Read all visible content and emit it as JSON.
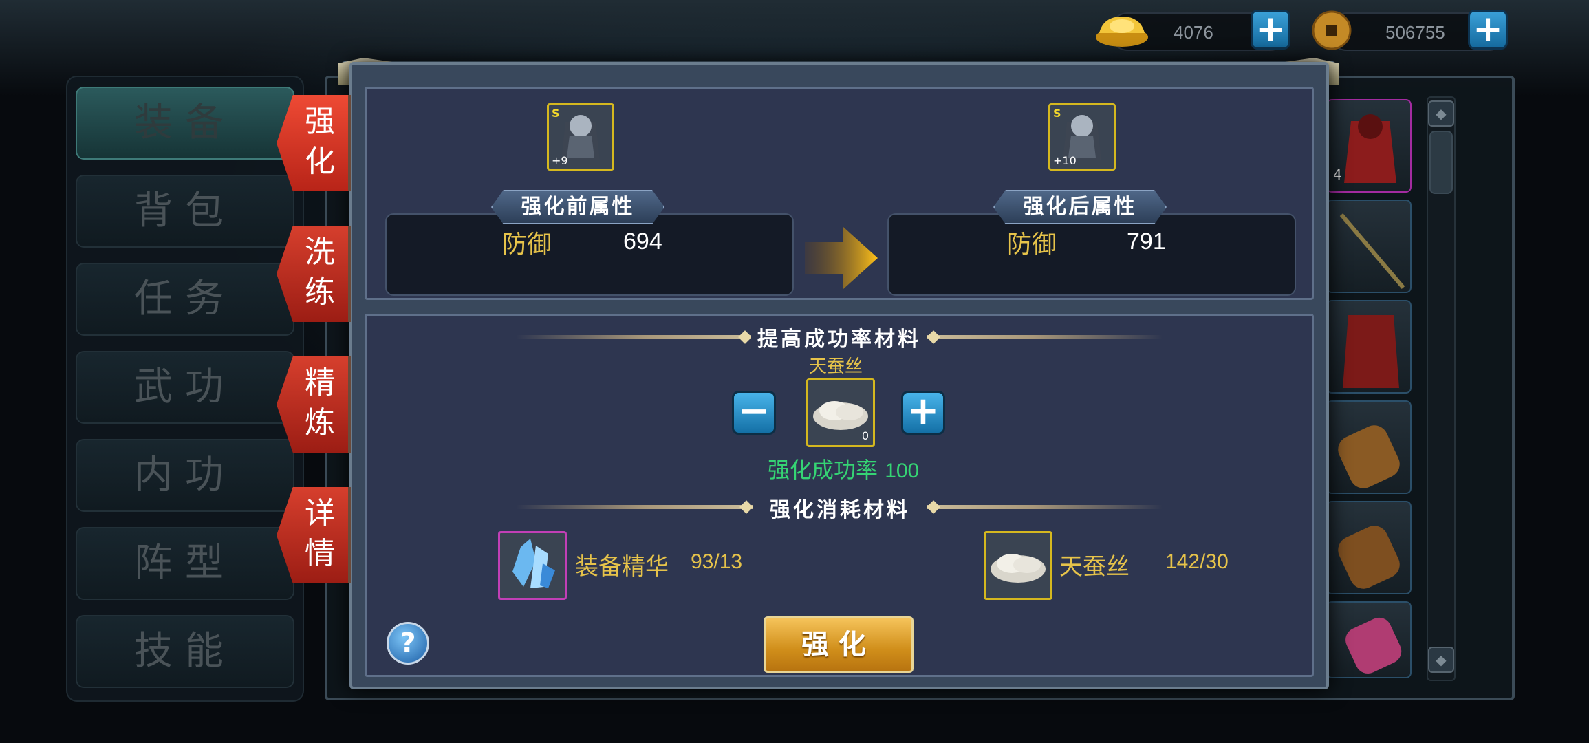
{
  "currency": {
    "gold_ingot": "4076",
    "copper_coin": "506755"
  },
  "left_menu": [
    "装备",
    "背包",
    "任务",
    "武功",
    "内功",
    "阵型",
    "技能"
  ],
  "side_tabs": [
    {
      "top": "强",
      "bottom": "化"
    },
    {
      "top": "洗",
      "bottom": "练"
    },
    {
      "top": "精",
      "bottom": "炼"
    },
    {
      "top": "详",
      "bottom": "情"
    }
  ],
  "enhance": {
    "before_badge": "S",
    "before_level": "+9",
    "after_badge": "S",
    "after_level": "+10",
    "before_title": "强化前属性",
    "after_title": "强化后属性",
    "attr_name_before": "防御",
    "attr_value_before": "694",
    "attr_name_after": "防御",
    "attr_value_after": "791"
  },
  "boost": {
    "title": "提高成功率材料",
    "material_name": "天蚕丝",
    "material_count": "0",
    "rate_label": "强化成功率",
    "rate_value": "100"
  },
  "cost": {
    "title": "强化消耗材料",
    "items": [
      {
        "name": "装备精华",
        "amount": "93/13"
      },
      {
        "name": "天蚕丝",
        "amount": "142/30"
      }
    ]
  },
  "button_label": "强化",
  "help_label": "?",
  "list_slot_count": "4",
  "colors": {
    "accent_gold": "#e6c34a",
    "success_green": "#35d474",
    "tab_red": "#d63f2d"
  }
}
